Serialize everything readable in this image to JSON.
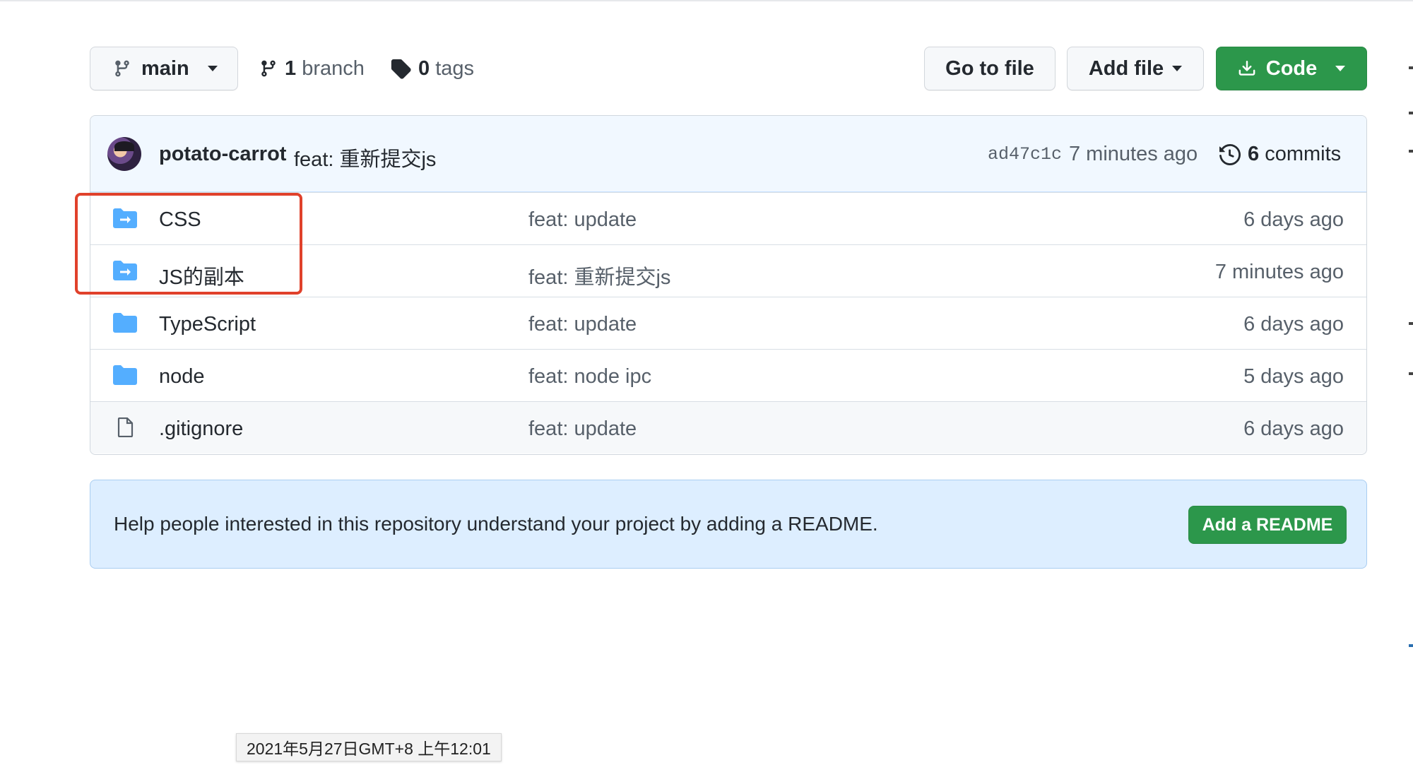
{
  "toolbar": {
    "branch_button_label": "main",
    "branches": {
      "count": "1",
      "label": "branch"
    },
    "tags": {
      "count": "0",
      "label": "tags"
    },
    "go_to_file_label": "Go to file",
    "add_file_label": "Add file",
    "code_label": "Code"
  },
  "latest_commit": {
    "author": "potato-carrot",
    "message": "feat: 重新提交js",
    "sha": "ad47c1c",
    "time": "7 minutes ago",
    "commits_count": "6",
    "commits_label": "commits"
  },
  "files": [
    {
      "icon": "submodule-folder-icon",
      "name": "CSS",
      "message": "feat: update",
      "age": "6 days ago"
    },
    {
      "icon": "submodule-folder-icon",
      "name": "JS的副本",
      "message": "feat: 重新提交js",
      "age": "7 minutes ago"
    },
    {
      "icon": "folder-icon",
      "name": "TypeScript",
      "message": "feat: update",
      "age": "6 days ago"
    },
    {
      "icon": "folder-icon",
      "name": "node",
      "message": "feat: node ipc",
      "age": "5 days ago"
    },
    {
      "icon": "file-icon",
      "name": ".gitignore",
      "message": "feat: update",
      "age": "6 days ago"
    }
  ],
  "readme_banner": {
    "text": "Help people interested in this repository understand your project by adding a README.",
    "button_label": "Add a README"
  },
  "tooltip": {
    "text": "2021年5月27日GMT+8 上午12:01"
  },
  "colors": {
    "primary_green": "#2c974b",
    "commit_bar_bg": "#f1f8ff",
    "readme_bg": "#ddeeff",
    "folder_blue": "#54aeff",
    "highlight_red": "#e0412b"
  }
}
